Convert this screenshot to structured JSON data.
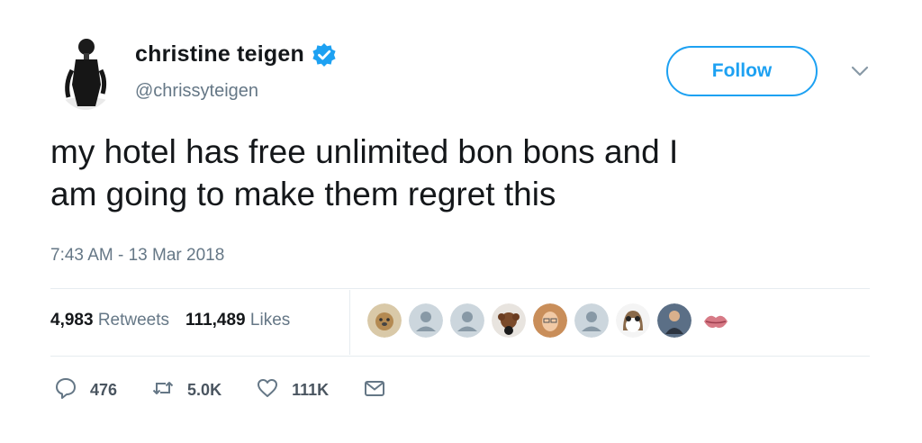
{
  "user": {
    "display_name": "christine teigen",
    "handle": "@chrissyteigen",
    "verified": true,
    "avatar_icon": "user-avatar"
  },
  "header": {
    "follow_label": "Follow",
    "menu_icon": "chevron-down-icon"
  },
  "tweet": {
    "text": "my hotel has free unlimited bon bons and I\nam going to make them regret this",
    "timestamp": "7:43 AM - 13 Mar 2018"
  },
  "stats": {
    "retweets_count": "4,983",
    "retweets_label": "Retweets",
    "likes_count": "111,489",
    "likes_label": "Likes"
  },
  "likers": [
    "dog-avatar",
    "default-avatar",
    "default-avatar",
    "puppy-avatar",
    "woman-avatar",
    "default-avatar",
    "porg-avatar",
    "man-avatar",
    "lips-avatar"
  ],
  "actions": {
    "reply_count": "476",
    "retweet_count": "5.0K",
    "like_count": "111K"
  },
  "colors": {
    "brand_blue": "#1da1f2",
    "muted_text": "#657786",
    "divider": "#e6ecf0"
  }
}
